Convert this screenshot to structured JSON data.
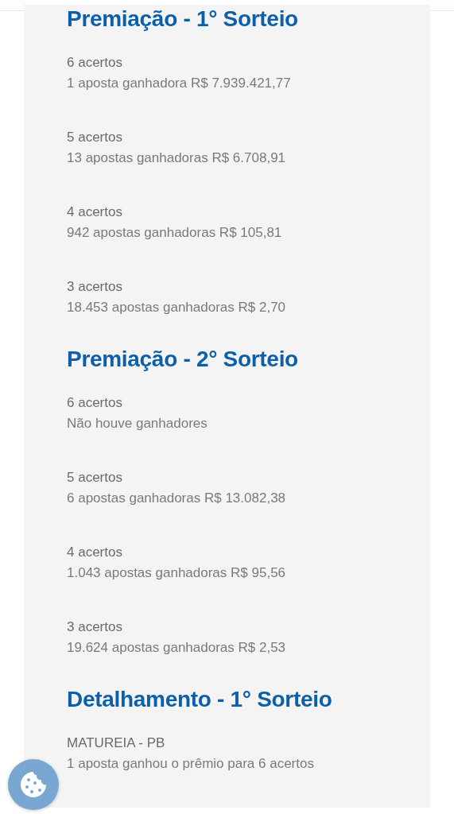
{
  "sections": [
    {
      "title": "Premiação - 1° Sorteio",
      "items": [
        {
          "label": "6 acertos",
          "value": "1 aposta ganhadora R$ 7.939.421,77"
        },
        {
          "label": "5 acertos",
          "value": "13 apostas ganhadoras R$ 6.708,91"
        },
        {
          "label": "4 acertos",
          "value": "942 apostas ganhadoras R$ 105,81"
        },
        {
          "label": "3 acertos",
          "value": "18.453 apostas ganhadoras R$ 2,70"
        }
      ]
    },
    {
      "title": "Premiação - 2° Sorteio",
      "items": [
        {
          "label": "6 acertos",
          "value": "Não houve ganhadores"
        },
        {
          "label": "5 acertos",
          "value": "6 apostas ganhadoras R$ 13.082,38"
        },
        {
          "label": "4 acertos",
          "value": "1.043 apostas ganhadoras R$ 95,56"
        },
        {
          "label": "3 acertos",
          "value": "19.624 apostas ganhadoras R$ 2,53"
        }
      ]
    },
    {
      "title": "Detalhamento - 1° Sorteio",
      "items": [
        {
          "label": "MATUREIA - PB",
          "value": "1 aposta ganhou o prêmio para 6 acertos"
        }
      ]
    }
  ]
}
